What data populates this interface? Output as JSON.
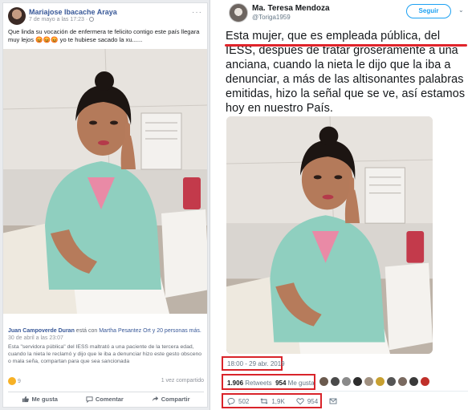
{
  "facebook": {
    "author": "Mariajose Ibacache Araya",
    "time": "7 de mayo a las 17:23 ·",
    "text": "Que linda su vocación de enfermera te felicito contigo este país llegara muy lejos 😡😡😡 yo te hubiese sacado la xu......",
    "shared": {
      "author": "Juan Campoverde Duran",
      "middle": " está con ",
      "tagged": "Martha Pesantez Ort y 20 personas más.",
      "date": "30 de abril a las 23:07",
      "body": "Esta \"servidora pública\" del IESS maltrató a una paciente de la tercera edad, cuando la nieta le reclamó y dijo que le iba a denunciar hizo este gesto obsceno o mala seña, compartan para que sea sancionada"
    },
    "reactions_count": "9",
    "shares": "1 vez compartido",
    "actions": {
      "like": "Me gusta",
      "comment": "Comentar",
      "share": "Compartir"
    }
  },
  "twitter": {
    "name": "Ma. Teresa Mendoza",
    "handle": "@Toriga1959",
    "follow_label": "Seguir",
    "text": "Esta mujer, que es empleada pública, del IESS, después de tratar groseramente a una anciana, cuando la nieta le dijo que la iba a denunciar, a más de las altisonantes palabras emitidas, hizo la señal que se ve, así estamos hoy en nuestro País.",
    "date": "18:00 - 29 abr. 2019",
    "retweets_count": "1.906",
    "retweets_label": "Retweets",
    "likes_count": "954",
    "likes_label": "Me gusta",
    "actions": {
      "replies": "502",
      "retweets": "1,9K",
      "likes": "954"
    }
  },
  "colors": {
    "fb_blue": "#385898",
    "tw_blue": "#1da1f2",
    "highlight_red": "#d9242a"
  },
  "icons": [
    "globe-icon",
    "like-icon",
    "comment-icon",
    "share-icon",
    "reply-icon",
    "retweet-icon",
    "heart-icon",
    "mail-icon",
    "chevron-down-icon"
  ]
}
